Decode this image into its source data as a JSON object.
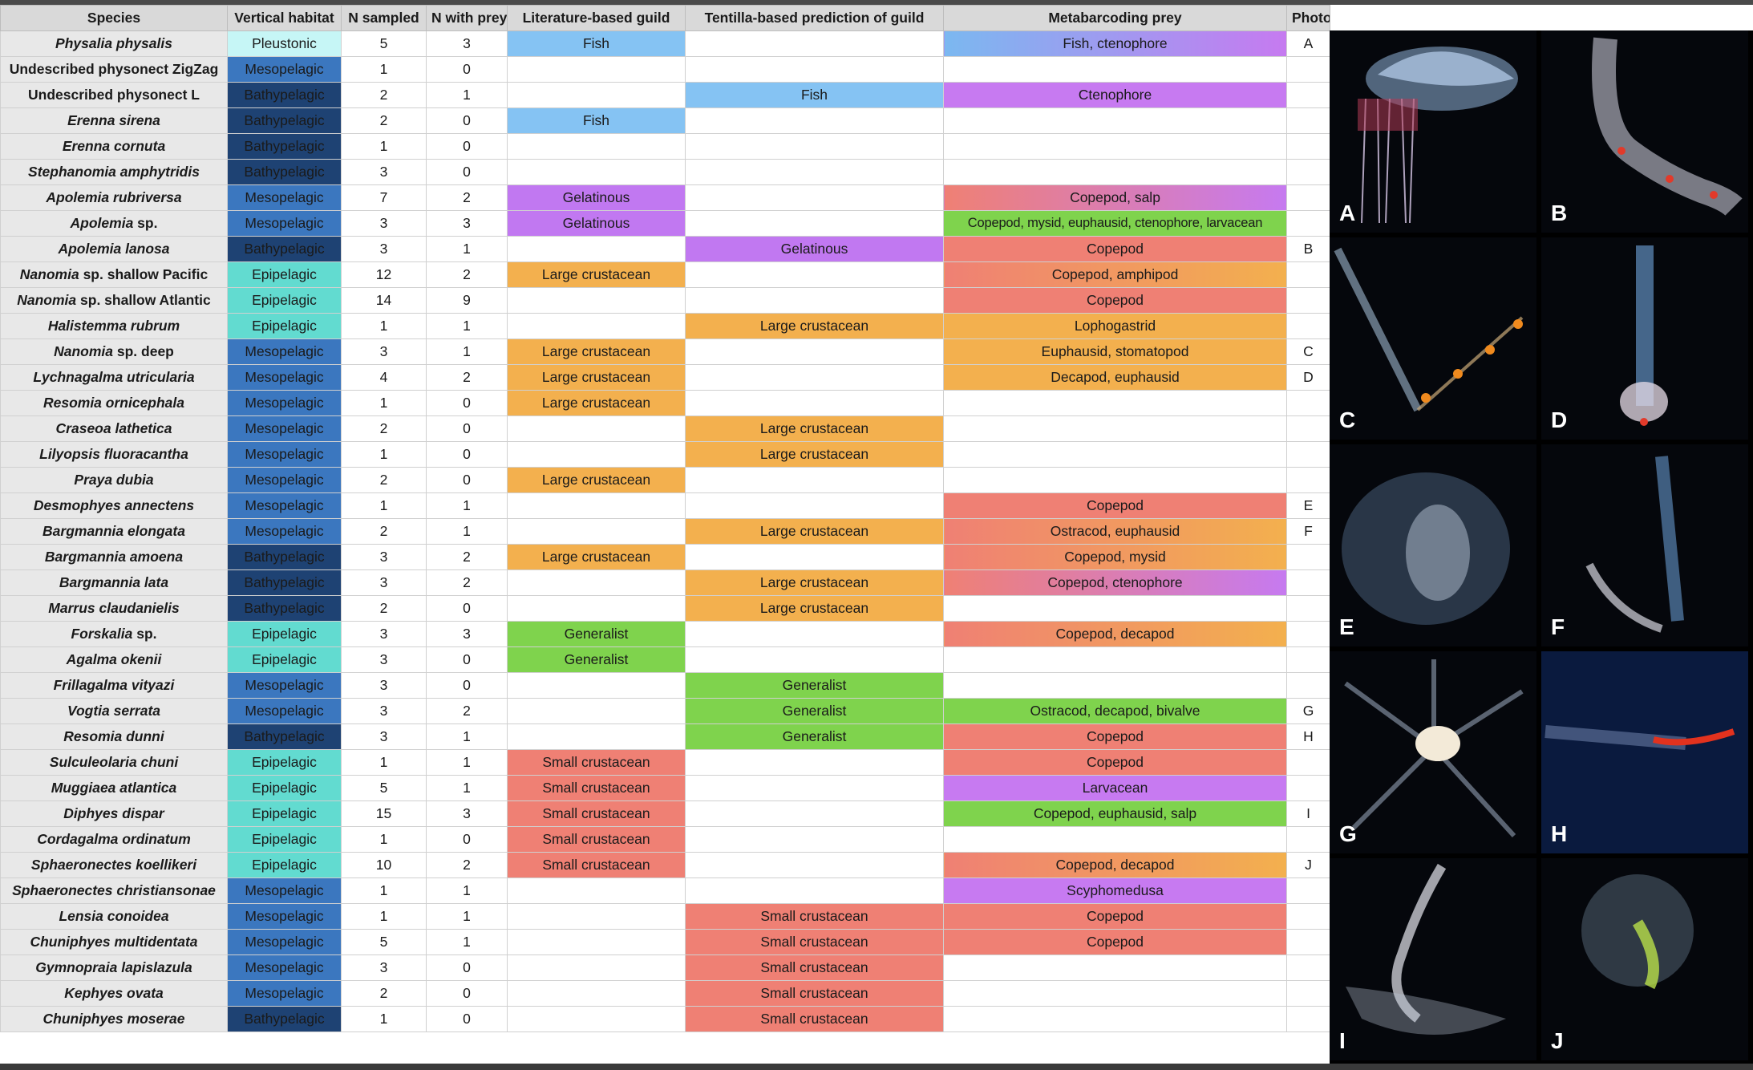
{
  "headers": [
    "Species",
    "Vertical habitat",
    "N sampled",
    "N with prey",
    "Literature-based guild",
    "Tentilla-based prediction of guild",
    "Metabarcoding prey",
    "Photo"
  ],
  "rows": [
    {
      "species": "Physalia physalis",
      "italic": true,
      "habitat": "Pleustonic",
      "hcls": "pleu",
      "n": "5",
      "np": "3",
      "lit": "Fish",
      "litc": "g-fish",
      "tent": "",
      "tentc": "",
      "prey": "Fish, ctenophore",
      "preyc": "p-fc",
      "photo": "A"
    },
    {
      "species": "Undescribed physonect ZigZag",
      "italic": false,
      "habitat": "Mesopelagic",
      "hcls": "meso",
      "n": "1",
      "np": "0",
      "lit": "",
      "litc": "",
      "tent": "",
      "tentc": "",
      "prey": "",
      "preyc": "",
      "photo": ""
    },
    {
      "species": "Undescribed physonect L",
      "italic": false,
      "habitat": "Bathypelagic",
      "hcls": "bathy",
      "n": "2",
      "np": "1",
      "lit": "",
      "litc": "",
      "tent": "Fish",
      "tentc": "g-fish",
      "prey": "Ctenophore",
      "preyc": "p-cten",
      "photo": ""
    },
    {
      "species": "Erenna sirena",
      "italic": true,
      "habitat": "Bathypelagic",
      "hcls": "bathy",
      "n": "2",
      "np": "0",
      "lit": "Fish",
      "litc": "g-fish",
      "tent": "",
      "tentc": "",
      "prey": "",
      "preyc": "",
      "photo": ""
    },
    {
      "species": "Erenna cornuta",
      "italic": true,
      "habitat": "Bathypelagic",
      "hcls": "bathy",
      "n": "1",
      "np": "0",
      "lit": "",
      "litc": "",
      "tent": "",
      "tentc": "",
      "prey": "",
      "preyc": "",
      "photo": ""
    },
    {
      "species": "Stephanomia amphytridis",
      "italic": true,
      "habitat": "Bathypelagic",
      "hcls": "bathy",
      "n": "3",
      "np": "0",
      "lit": "",
      "litc": "",
      "tent": "",
      "tentc": "",
      "prey": "",
      "preyc": "",
      "photo": ""
    },
    {
      "species": "Apolemia rubriversa",
      "italic": true,
      "habitat": "Mesopelagic",
      "hcls": "meso",
      "n": "7",
      "np": "2",
      "lit": "Gelatinous",
      "litc": "g-gel",
      "tent": "",
      "tentc": "",
      "prey": "Copepod, salp",
      "preyc": "p-cs",
      "photo": ""
    },
    {
      "species": "Apolemia",
      "suffix": " sp.",
      "italic": true,
      "habitat": "Mesopelagic",
      "hcls": "meso",
      "n": "3",
      "np": "3",
      "lit": "Gelatinous",
      "litc": "g-gel",
      "tent": "",
      "tentc": "",
      "prey": "Copepod, mysid, euphausid, ctenophore, larvacean",
      "preyc": "p-big",
      "photo": ""
    },
    {
      "species": "Apolemia lanosa",
      "italic": true,
      "habitat": "Bathypelagic",
      "hcls": "bathy",
      "n": "3",
      "np": "1",
      "lit": "",
      "litc": "",
      "tent": "Gelatinous",
      "tentc": "g-gel",
      "prey": "Copepod",
      "preyc": "p-cope",
      "photo": "B"
    },
    {
      "species": "Nanomia",
      "suffix": " sp. shallow Pacific",
      "italic": true,
      "habitat": "Epipelagic",
      "hcls": "epi",
      "n": "12",
      "np": "2",
      "lit": "Large crustacean",
      "litc": "g-lc",
      "tent": "",
      "tentc": "",
      "prey": "Copepod, amphipod",
      "preyc": "p-cd",
      "photo": ""
    },
    {
      "species": "Nanomia",
      "suffix": " sp. shallow Atlantic",
      "italic": true,
      "habitat": "Epipelagic",
      "hcls": "epi",
      "n": "14",
      "np": "9",
      "lit": "",
      "litc": "",
      "tent": "",
      "tentc": "",
      "prey": "Copepod",
      "preyc": "p-cope",
      "photo": ""
    },
    {
      "species": "Halistemma rubrum",
      "italic": true,
      "habitat": "Epipelagic",
      "hcls": "epi",
      "n": "1",
      "np": "1",
      "lit": "",
      "litc": "",
      "tent": "Large crustacean",
      "tentc": "g-lc",
      "prey": "Lophogastrid",
      "preyc": "p-lopho",
      "photo": ""
    },
    {
      "species": "Nanomia",
      "suffix": " sp. deep",
      "italic": true,
      "habitat": "Mesopelagic",
      "hcls": "meso",
      "n": "3",
      "np": "1",
      "lit": "Large crustacean",
      "litc": "g-lc",
      "tent": "",
      "tentc": "",
      "prey": "Euphausid, stomatopod",
      "preyc": "p-euph",
      "photo": "C"
    },
    {
      "species": "Lychnagalma utricularia",
      "italic": true,
      "habitat": "Mesopelagic",
      "hcls": "meso",
      "n": "4",
      "np": "2",
      "lit": "Large crustacean",
      "litc": "g-lc",
      "tent": "",
      "tentc": "",
      "prey": "Decapod, euphausid",
      "preyc": "p-euph",
      "photo": "D"
    },
    {
      "species": "Resomia ornicephala",
      "italic": true,
      "habitat": "Mesopelagic",
      "hcls": "meso",
      "n": "1",
      "np": "0",
      "lit": "Large crustacean",
      "litc": "g-lc",
      "tent": "",
      "tentc": "",
      "prey": "",
      "preyc": "",
      "photo": ""
    },
    {
      "species": "Craseoa lathetica",
      "italic": true,
      "habitat": "Mesopelagic",
      "hcls": "meso",
      "n": "2",
      "np": "0",
      "lit": "",
      "litc": "",
      "tent": "Large crustacean",
      "tentc": "g-lc",
      "prey": "",
      "preyc": "",
      "photo": ""
    },
    {
      "species": "Lilyopsis fluoracantha",
      "italic": true,
      "habitat": "Mesopelagic",
      "hcls": "meso",
      "n": "1",
      "np": "0",
      "lit": "",
      "litc": "",
      "tent": "Large crustacean",
      "tentc": "g-lc",
      "prey": "",
      "preyc": "",
      "photo": ""
    },
    {
      "species": "Praya dubia",
      "italic": true,
      "habitat": "Mesopelagic",
      "hcls": "meso",
      "n": "2",
      "np": "0",
      "lit": "Large crustacean",
      "litc": "g-lc",
      "tent": "",
      "tentc": "",
      "prey": "",
      "preyc": "",
      "photo": ""
    },
    {
      "species": "Desmophyes annectens",
      "italic": true,
      "habitat": "Mesopelagic",
      "hcls": "meso",
      "n": "1",
      "np": "1",
      "lit": "",
      "litc": "",
      "tent": "",
      "tentc": "",
      "prey": "Copepod",
      "preyc": "p-cope",
      "photo": "E"
    },
    {
      "species": "Bargmannia elongata",
      "italic": true,
      "habitat": "Mesopelagic",
      "hcls": "meso",
      "n": "2",
      "np": "1",
      "lit": "",
      "litc": "",
      "tent": "Large crustacean",
      "tentc": "g-lc",
      "prey": "Ostracod, euphausid",
      "preyc": "p-oe",
      "photo": "F"
    },
    {
      "species": "Bargmannia amoena",
      "italic": true,
      "habitat": "Bathypelagic",
      "hcls": "bathy",
      "n": "3",
      "np": "2",
      "lit": "Large crustacean",
      "litc": "g-lc",
      "tent": "",
      "tentc": "",
      "prey": "Copepod, mysid",
      "preyc": "p-oe",
      "photo": ""
    },
    {
      "species": "Bargmannia lata",
      "italic": true,
      "habitat": "Bathypelagic",
      "hcls": "bathy",
      "n": "3",
      "np": "2",
      "lit": "",
      "litc": "",
      "tent": "Large crustacean",
      "tentc": "g-lc",
      "prey": "Copepod, ctenophore",
      "preyc": "p-cs",
      "photo": ""
    },
    {
      "species": "Marrus claudanielis",
      "italic": true,
      "habitat": "Bathypelagic",
      "hcls": "bathy",
      "n": "2",
      "np": "0",
      "lit": "",
      "litc": "",
      "tent": "Large crustacean",
      "tentc": "g-lc",
      "prey": "",
      "preyc": "",
      "photo": ""
    },
    {
      "species": "Forskalia",
      "suffix": " sp.",
      "italic": true,
      "habitat": "Epipelagic",
      "hcls": "epi",
      "n": "3",
      "np": "3",
      "lit": "Generalist",
      "litc": "g-gen",
      "tent": "",
      "tentc": "",
      "prey": "Copepod, decapod",
      "preyc": "p-cd",
      "photo": ""
    },
    {
      "species": "Agalma okenii",
      "italic": true,
      "habitat": "Epipelagic",
      "hcls": "epi",
      "n": "3",
      "np": "0",
      "lit": "Generalist",
      "litc": "g-gen",
      "tent": "",
      "tentc": "",
      "prey": "",
      "preyc": "",
      "photo": ""
    },
    {
      "species": "Frillagalma vityazi",
      "italic": true,
      "habitat": "Mesopelagic",
      "hcls": "meso",
      "n": "3",
      "np": "0",
      "lit": "",
      "litc": "",
      "tent": "Generalist",
      "tentc": "g-gen",
      "prey": "",
      "preyc": "",
      "photo": ""
    },
    {
      "species": "Vogtia serrata",
      "italic": true,
      "habitat": "Mesopelagic",
      "hcls": "meso",
      "n": "3",
      "np": "2",
      "lit": "",
      "litc": "",
      "tent": "Generalist",
      "tentc": "g-gen",
      "prey": "Ostracod, decapod, bivalve",
      "preyc": "p-gen",
      "photo": "G"
    },
    {
      "species": "Resomia dunni",
      "italic": true,
      "habitat": "Bathypelagic",
      "hcls": "bathy",
      "n": "3",
      "np": "1",
      "lit": "",
      "litc": "",
      "tent": "Generalist",
      "tentc": "g-gen",
      "prey": "Copepod",
      "preyc": "p-cope",
      "photo": "H"
    },
    {
      "species": "Sulculeolaria chuni",
      "italic": true,
      "habitat": "Epipelagic",
      "hcls": "epi",
      "n": "1",
      "np": "1",
      "lit": "Small crustacean",
      "litc": "g-sc",
      "tent": "",
      "tentc": "",
      "prey": "Copepod",
      "preyc": "p-cope",
      "photo": ""
    },
    {
      "species": "Muggiaea atlantica",
      "italic": true,
      "habitat": "Epipelagic",
      "hcls": "epi",
      "n": "5",
      "np": "1",
      "lit": "Small crustacean",
      "litc": "g-sc",
      "tent": "",
      "tentc": "",
      "prey": "Larvacean",
      "preyc": "p-larv",
      "photo": ""
    },
    {
      "species": "Diphyes dispar",
      "italic": true,
      "habitat": "Epipelagic",
      "hcls": "epi",
      "n": "15",
      "np": "3",
      "lit": "Small crustacean",
      "litc": "g-sc",
      "tent": "",
      "tentc": "",
      "prey": "Copepod, euphausid, salp",
      "preyc": "p-gen",
      "photo": "I"
    },
    {
      "species": "Cordagalma ordinatum",
      "italic": true,
      "habitat": "Epipelagic",
      "hcls": "epi",
      "n": "1",
      "np": "0",
      "lit": "Small crustacean",
      "litc": "g-sc",
      "tent": "",
      "tentc": "",
      "prey": "",
      "preyc": "",
      "photo": ""
    },
    {
      "species": "Sphaeronectes koellikeri",
      "italic": true,
      "habitat": "Epipelagic",
      "hcls": "epi",
      "n": "10",
      "np": "2",
      "lit": "Small crustacean",
      "litc": "g-sc",
      "tent": "",
      "tentc": "",
      "prey": "Copepod, decapod",
      "preyc": "p-cd",
      "photo": "J"
    },
    {
      "species": "Sphaeronectes christiansonae",
      "italic": true,
      "habitat": "Mesopelagic",
      "hcls": "meso",
      "n": "1",
      "np": "1",
      "lit": "",
      "litc": "",
      "tent": "",
      "tentc": "",
      "prey": "Scyphomedusa",
      "preyc": "p-scy",
      "photo": ""
    },
    {
      "species": "Lensia conoidea",
      "italic": true,
      "habitat": "Mesopelagic",
      "hcls": "meso",
      "n": "1",
      "np": "1",
      "lit": "",
      "litc": "",
      "tent": "Small crustacean",
      "tentc": "g-sc",
      "prey": "Copepod",
      "preyc": "p-cope",
      "photo": ""
    },
    {
      "species": "Chuniphyes multidentata",
      "italic": true,
      "habitat": "Mesopelagic",
      "hcls": "meso",
      "n": "5",
      "np": "1",
      "lit": "",
      "litc": "",
      "tent": "Small crustacean",
      "tentc": "g-sc",
      "prey": "Copepod",
      "preyc": "p-cope",
      "photo": ""
    },
    {
      "species": "Gymnopraia lapislazula",
      "italic": true,
      "habitat": "Mesopelagic",
      "hcls": "meso",
      "n": "3",
      "np": "0",
      "lit": "",
      "litc": "",
      "tent": "Small crustacean",
      "tentc": "g-sc",
      "prey": "",
      "preyc": "",
      "photo": ""
    },
    {
      "species": "Kephyes ovata",
      "italic": true,
      "habitat": "Mesopelagic",
      "hcls": "meso",
      "n": "2",
      "np": "0",
      "lit": "",
      "litc": "",
      "tent": "Small crustacean",
      "tentc": "g-sc",
      "prey": "",
      "preyc": "",
      "photo": ""
    },
    {
      "species": "Chuniphyes moserae",
      "italic": true,
      "habitat": "Bathypelagic",
      "hcls": "bathy",
      "n": "1",
      "np": "0",
      "lit": "",
      "litc": "",
      "tent": "Small crustacean",
      "tentc": "g-sc",
      "prey": "",
      "preyc": "",
      "photo": ""
    }
  ],
  "photo_labels": [
    "A",
    "B",
    "C",
    "D",
    "E",
    "F",
    "G",
    "H",
    "I",
    "J"
  ]
}
